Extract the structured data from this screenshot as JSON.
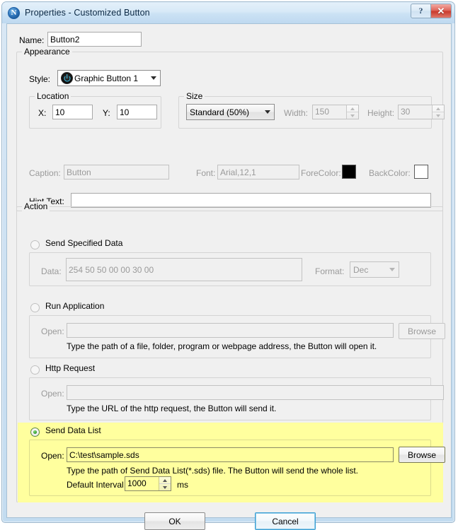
{
  "window": {
    "title": "Properties - Customized Button",
    "app_icon": "app-logo-icon",
    "help_button": "?",
    "close_button": "✕"
  },
  "name_field": {
    "label": "Name:",
    "value": "Button2"
  },
  "appearance": {
    "legend": "Appearance",
    "style": {
      "label": "Style:",
      "value": "Graphic Button 1",
      "icon": "power-button-icon"
    },
    "location": {
      "legend": "Location",
      "x_label": "X:",
      "x_value": "10",
      "y_label": "Y:",
      "y_value": "10"
    },
    "size": {
      "legend": "Size",
      "preset": "Standard    (50%)",
      "width_label": "Width:",
      "width_value": "150",
      "height_label": "Height:",
      "height_value": "30"
    },
    "caption": {
      "label": "Caption:",
      "value": "Button"
    },
    "font": {
      "label": "Font:",
      "value": "Arial,12,1"
    },
    "fore_color": {
      "label": "ForeColor:",
      "color": "#000000"
    },
    "back_color": {
      "label": "BackColor:",
      "color": "#ffffff"
    },
    "hint_text": {
      "label": "Hint Text:",
      "value": ""
    }
  },
  "action": {
    "legend": "Action",
    "options": [
      {
        "id": "send-specified-data",
        "label": "Send Specified Data",
        "selected": false,
        "data_label": "Data:",
        "data_value": "254 50 50 00 00 30 00",
        "format_label": "Format:",
        "format_value": "Dec"
      },
      {
        "id": "run-application",
        "label": "Run Application",
        "selected": false,
        "open_label": "Open:",
        "open_value": "",
        "browse_label": "Browse",
        "help_text": "Type the path of a file, folder, program or webpage address, the Button will open it."
      },
      {
        "id": "http-request",
        "label": "Http Request",
        "selected": false,
        "open_label": "Open:",
        "open_value": "",
        "help_text": "Type the URL of the http request, the Button will send it."
      },
      {
        "id": "send-data-list",
        "label": "Send Data List",
        "selected": true,
        "open_label": "Open:",
        "open_value": "C:\\test\\sample.sds",
        "browse_label": "Browse",
        "help_text": "Type the path of Send Data List(*.sds) file. The Button will send the whole list.",
        "interval_label": "Default Interval",
        "interval_value": "1000",
        "interval_unit": "ms"
      }
    ]
  },
  "footer": {
    "ok_label": "OK",
    "cancel_label": "Cancel"
  },
  "colors": {
    "highlight_background": "#ffff9e",
    "dialog_background": "#f0f0f0",
    "focus_ring": "#3c9fd4"
  }
}
